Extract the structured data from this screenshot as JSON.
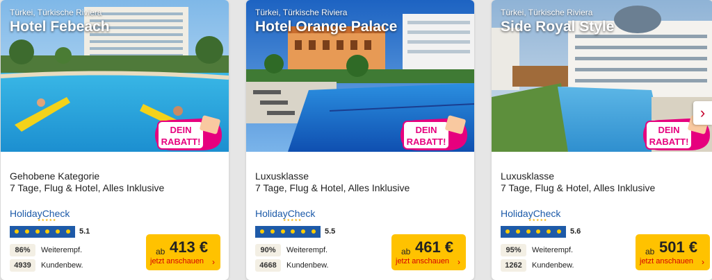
{
  "rabatt_badge": {
    "line1": "DEIN",
    "line2": "RABATT!"
  },
  "hc_stars": "★★★★★",
  "cards": [
    {
      "region": "Türkei, Türkische Riviera",
      "name": "Hotel Febeach",
      "category": "Gehobene Kategorie",
      "package": "7 Tage, Flug & Hotel, Alles Inklusive",
      "review_brand": "HolidayCheck",
      "sun_count": 6,
      "score": "5.1",
      "recommend_pct": "86%",
      "recommend_label": "Weiterempf.",
      "review_count": "4939",
      "review_label": "Kundenbew.",
      "price_prefix": "ab",
      "price": "413 €",
      "cta": "jetzt anschauen"
    },
    {
      "region": "Türkei, Türkische Riviera",
      "name": "Hotel Orange Palace",
      "category": "Luxusklasse",
      "package": "7 Tage, Flug & Hotel, Alles Inklusive",
      "review_brand": "HolidayCheck",
      "sun_count": 6,
      "score": "5.5",
      "recommend_pct": "90%",
      "recommend_label": "Weiterempf.",
      "review_count": "4668",
      "review_label": "Kundenbew.",
      "price_prefix": "ab",
      "price": "461 €",
      "cta": "jetzt anschauen"
    },
    {
      "region": "Türkei, Türkische Riviera",
      "name": "Side Royal Style",
      "category": "Luxusklasse",
      "package": "7 Tage, Flug & Hotel, Alles Inklusive",
      "review_brand": "HolidayCheck",
      "sun_count": 6,
      "score": "5.6",
      "recommend_pct": "95%",
      "recommend_label": "Weiterempf.",
      "review_count": "1262",
      "review_label": "Kundenbew.",
      "price_prefix": "ab",
      "price": "501 €",
      "cta": "jetzt anschauen"
    }
  ],
  "carousel": {
    "next_icon": "chevron-right-icon",
    "glyph": "›"
  },
  "colors": {
    "cta_yellow": "#ffc200",
    "cta_text": "#d50000",
    "hc_blue": "#1e5aa8",
    "sun": "#ffcc00",
    "rabatt_pink": "#e6007e"
  }
}
